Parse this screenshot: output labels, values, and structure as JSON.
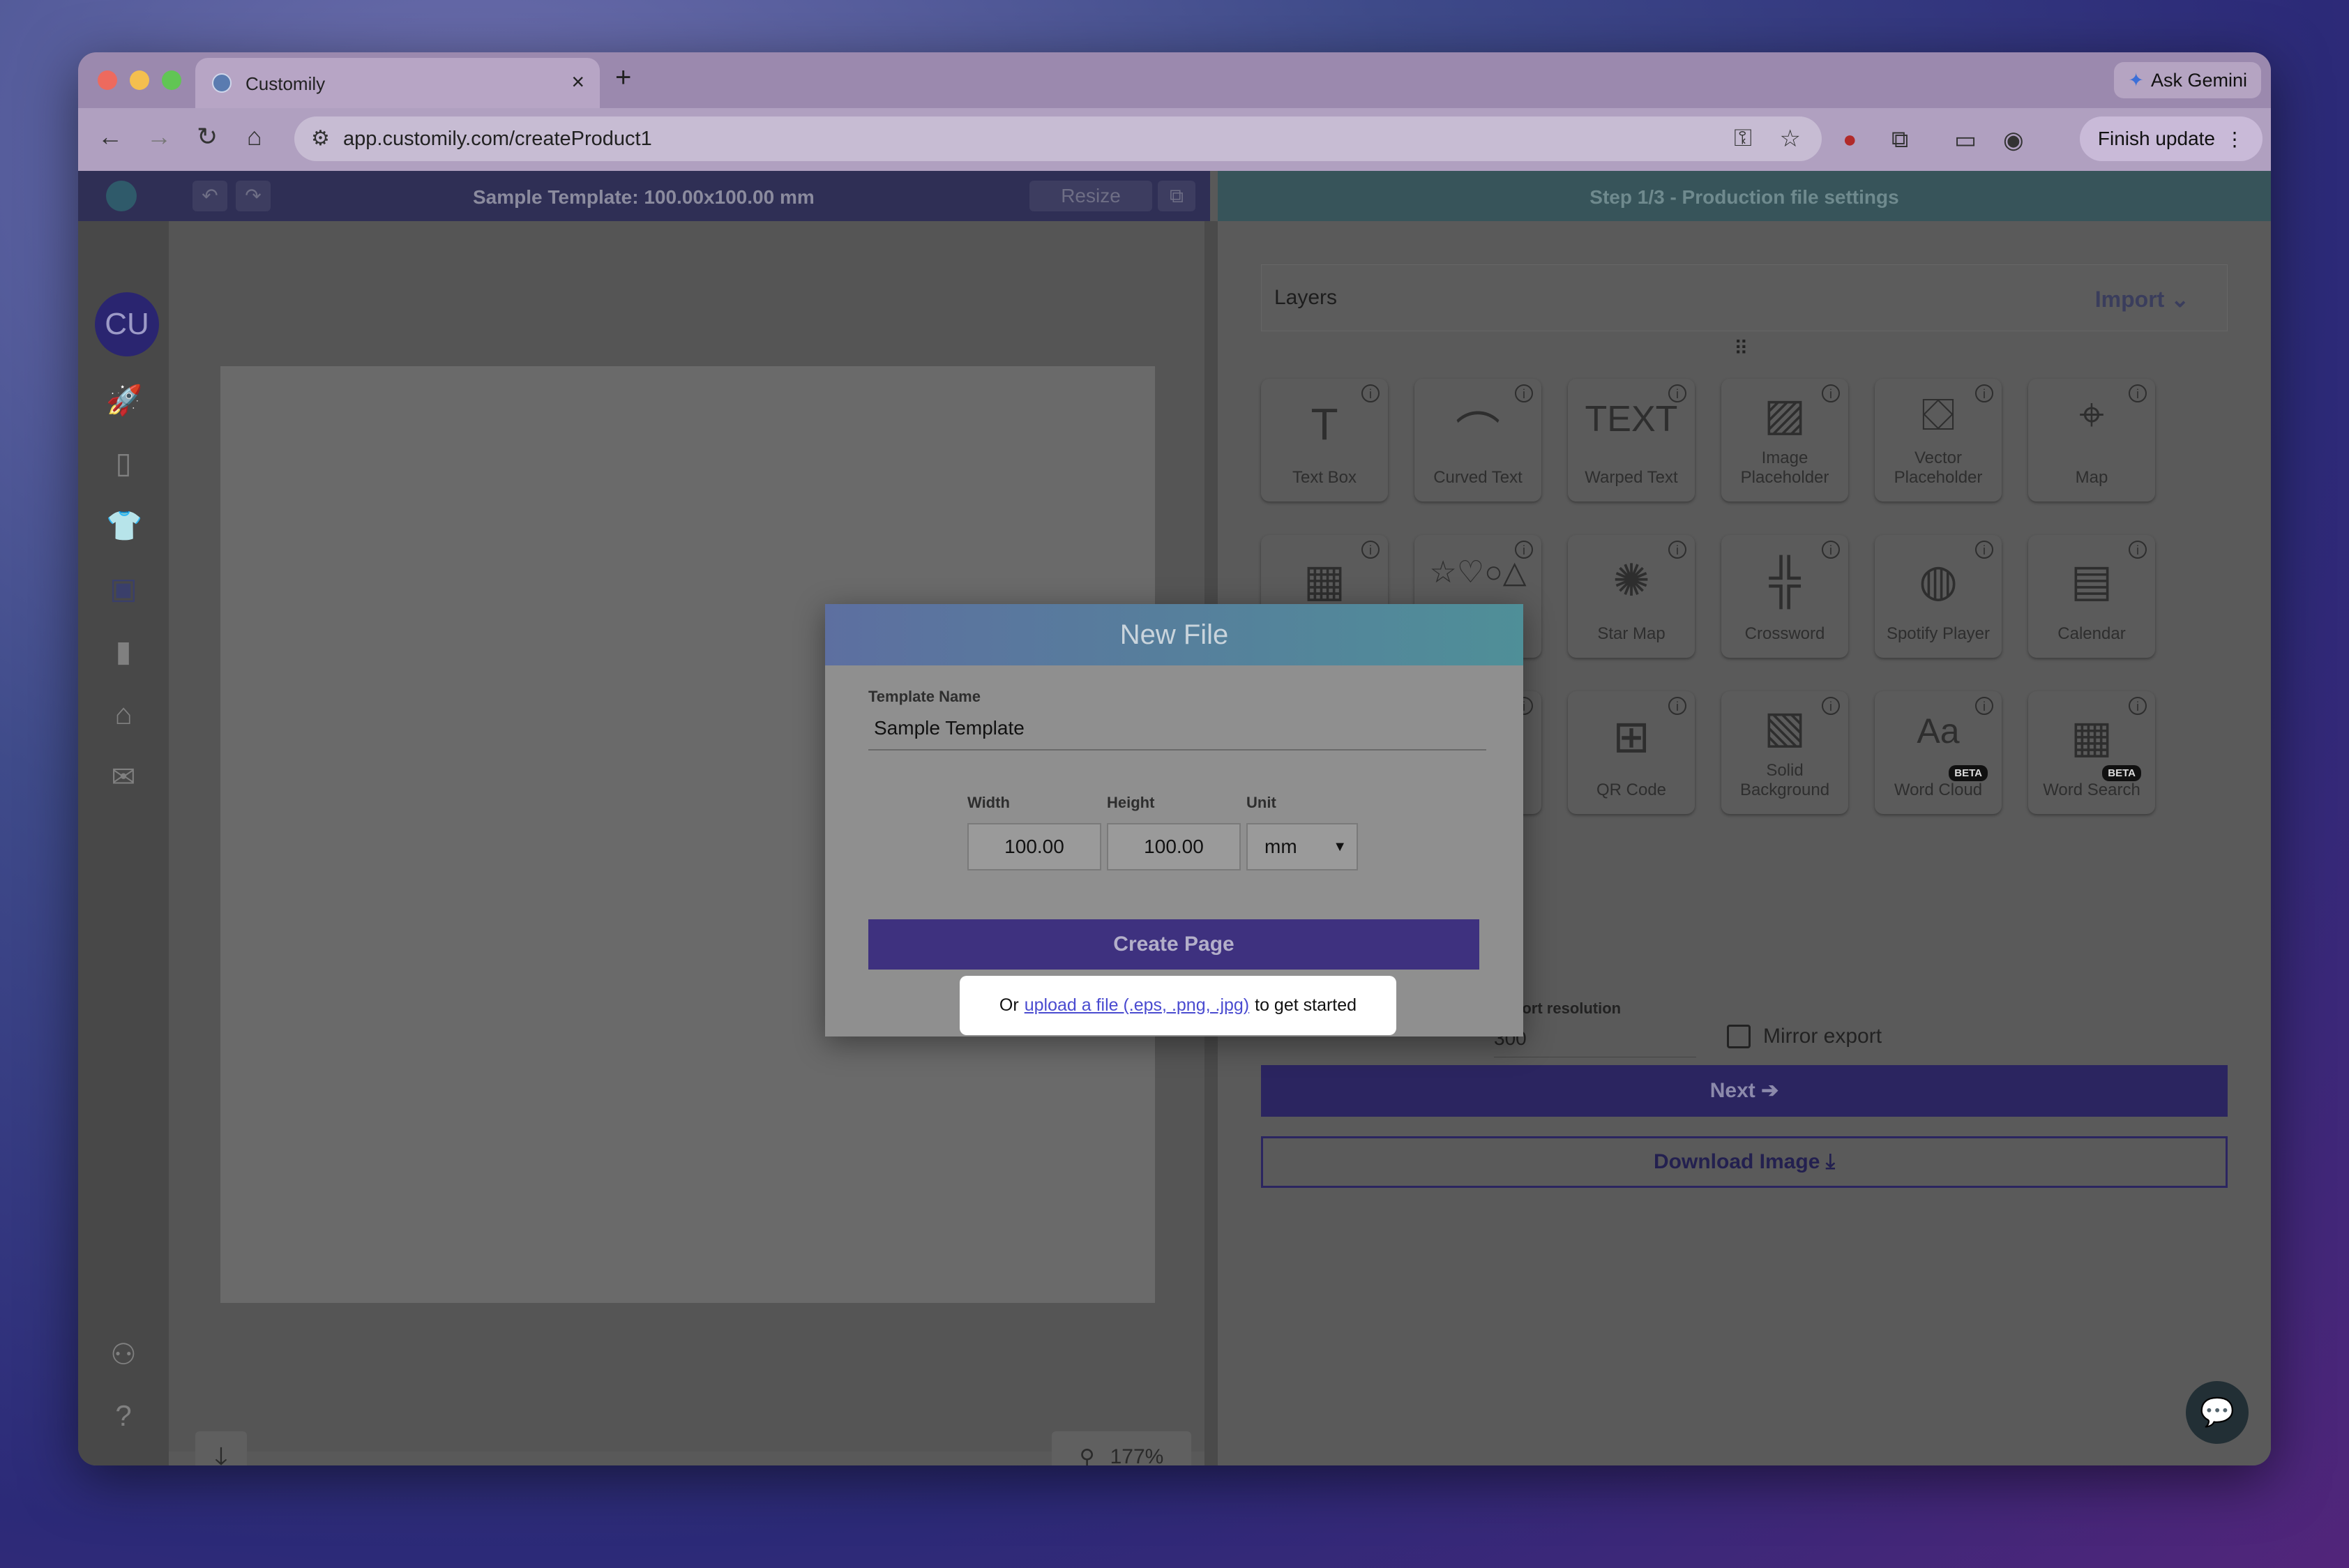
{
  "browser": {
    "tab_title": "Customily",
    "new_tab": "+",
    "ask_gemini": "Ask Gemini",
    "url": "app.customily.com/createProduct1",
    "finish_update": "Finish update"
  },
  "toolbar": {
    "template_title": "Sample Template: 100.00x100.00 mm",
    "resize": "Resize",
    "step_title": "Step 1/3 - Production file settings"
  },
  "sidebar": {
    "avatar_initials": "CU"
  },
  "canvas": {
    "zoom": "177%"
  },
  "layers_panel": {
    "title": "Layers",
    "import": "Import",
    "tools": [
      {
        "label": "Text Box",
        "icon": "text-box-icon"
      },
      {
        "label": "Curved Text",
        "icon": "curved-text-icon"
      },
      {
        "label": "Warped Text",
        "icon": "warped-text-icon"
      },
      {
        "label": "Image Placeholder",
        "icon": "image-placeholder-icon"
      },
      {
        "label": "Vector Placeholder",
        "icon": "vector-placeholder-icon"
      },
      {
        "label": "Map",
        "icon": "map-icon"
      },
      {
        "label": "Star Map",
        "icon": "star-map-icon"
      },
      {
        "label": "Crossword",
        "icon": "crossword-icon"
      },
      {
        "label": "Spotify Player",
        "icon": "spotify-player-icon"
      },
      {
        "label": "Calendar",
        "icon": "calendar-icon"
      },
      {
        "label": "QR Code",
        "icon": "qr-code-icon"
      },
      {
        "label": "Solid Background",
        "icon": "solid-background-icon"
      },
      {
        "label": "Word Cloud",
        "icon": "word-cloud-icon"
      },
      {
        "label": "Word Search",
        "icon": "word-search-icon"
      }
    ],
    "beta": "BETA",
    "export_resolution_label": "Export resolution",
    "export_resolution_value": "300",
    "mirror_export": "Mirror export",
    "next": "Next",
    "download_image": "Download Image"
  },
  "modal": {
    "title": "New File",
    "template_name_label": "Template Name",
    "template_name_value": "Sample Template",
    "width_label": "Width",
    "height_label": "Height",
    "unit_label": "Unit",
    "width_value": "100.00",
    "height_value": "100.00",
    "unit_value": "mm",
    "create_page": "Create Page",
    "upload_prefix": "Or",
    "upload_link": "upload a file (.eps, .png, .jpg)",
    "upload_suffix": "to get started"
  }
}
